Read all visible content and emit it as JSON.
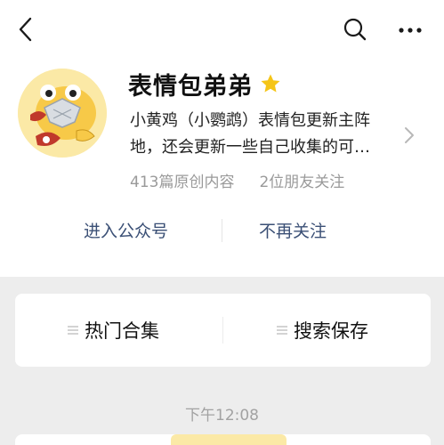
{
  "nav": {
    "back_icon": "chevron-left-icon",
    "search_icon": "search-icon",
    "more_icon": "more-dots-icon"
  },
  "account": {
    "name": "表情包弟弟",
    "starred": true,
    "description": "小黄鸡（小鹦鹉）表情包更新主阵地，还会更新一些自己收集的可…",
    "original_count": "413篇原创内容",
    "friends_following": "2位朋友关注"
  },
  "actions": {
    "enter": "进入公众号",
    "unfollow": "不再关注"
  },
  "menu": {
    "items": [
      {
        "label": "热门合集"
      },
      {
        "label": "搜索保存"
      }
    ]
  },
  "message": {
    "time": "下午12:08"
  },
  "colors": {
    "link": "#3a4f75",
    "star": "#f5c518",
    "avatar_bg": "#fbe9a6",
    "background": "#ededed"
  }
}
